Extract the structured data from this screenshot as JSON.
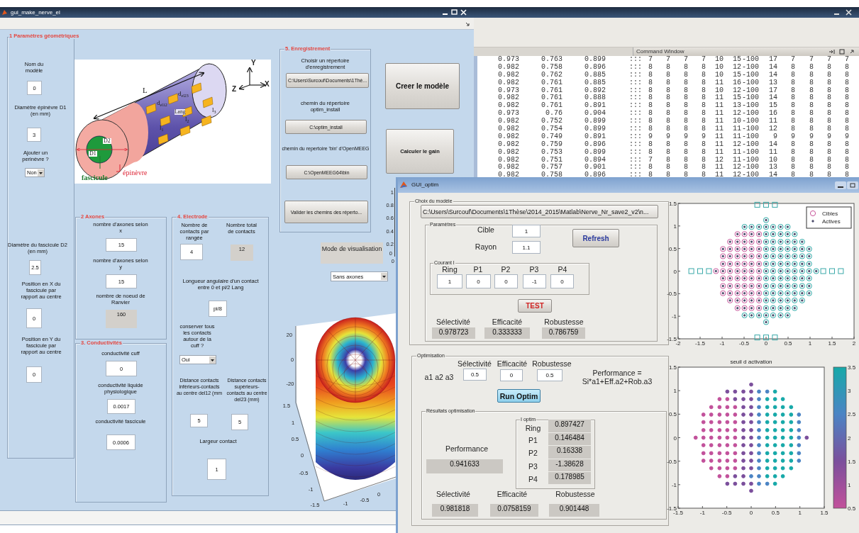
{
  "command_window": {
    "title": "Command Window",
    "rows": [
      [
        "0.973",
        "0.763",
        "0.899",
        ":::",
        "7",
        "7",
        "7",
        "7",
        "10",
        "15",
        "-100",
        "17",
        "7",
        "7",
        "7",
        "7"
      ],
      [
        "0.982",
        "0.758",
        "0.896",
        ":::",
        "8",
        "8",
        "8",
        "8",
        "10",
        "12",
        "-100",
        "14",
        "8",
        "8",
        "8",
        "8"
      ],
      [
        "0.982",
        "0.762",
        "0.885",
        ":::",
        "8",
        "8",
        "8",
        "8",
        "10",
        "15",
        "-100",
        "14",
        "8",
        "8",
        "8",
        "8"
      ],
      [
        "0.982",
        "0.761",
        "0.885",
        ":::",
        "8",
        "8",
        "8",
        "8",
        "11",
        "16",
        "-100",
        "13",
        "8",
        "8",
        "8",
        "8"
      ],
      [
        "0.973",
        "0.761",
        "0.892",
        ":::",
        "8",
        "8",
        "8",
        "8",
        "10",
        "12",
        "-100",
        "17",
        "8",
        "8",
        "8",
        "8"
      ],
      [
        "0.982",
        "0.761",
        "0.888",
        ":::",
        "8",
        "8",
        "8",
        "8",
        "11",
        "15",
        "-100",
        "14",
        "8",
        "8",
        "8",
        "8"
      ],
      [
        "0.982",
        "0.761",
        "0.891",
        ":::",
        "8",
        "8",
        "8",
        "8",
        "11",
        "13",
        "-100",
        "15",
        "8",
        "8",
        "8",
        "8"
      ],
      [
        "0.973",
        "0.76",
        "0.904",
        ":::",
        "8",
        "8",
        "8",
        "8",
        "11",
        "12",
        "-100",
        "16",
        "8",
        "8",
        "8",
        "8"
      ],
      [
        "0.982",
        "0.752",
        "0.899",
        ":::",
        "8",
        "8",
        "8",
        "8",
        "11",
        "10",
        "-100",
        "11",
        "8",
        "8",
        "8",
        "8"
      ],
      [
        "0.982",
        "0.754",
        "0.899",
        ":::",
        "8",
        "8",
        "8",
        "8",
        "11",
        "11",
        "-100",
        "12",
        "8",
        "8",
        "8",
        "8"
      ],
      [
        "0.982",
        "0.749",
        "0.891",
        ":::",
        "9",
        "9",
        "9",
        "9",
        "11",
        "11",
        "-100",
        "9",
        "9",
        "9",
        "9",
        "9"
      ],
      [
        "0.982",
        "0.759",
        "0.896",
        ":::",
        "8",
        "8",
        "8",
        "8",
        "11",
        "12",
        "-100",
        "14",
        "8",
        "8",
        "8",
        "8"
      ],
      [
        "0.982",
        "0.753",
        "0.899",
        ":::",
        "8",
        "8",
        "8",
        "8",
        "11",
        "11",
        "-100",
        "11",
        "8",
        "8",
        "8",
        "8"
      ],
      [
        "0.982",
        "0.751",
        "0.894",
        ":::",
        "7",
        "8",
        "8",
        "8",
        "12",
        "11",
        "-100",
        "10",
        "8",
        "8",
        "8",
        "8"
      ],
      [
        "0.982",
        "0.757",
        "0.901",
        ":::",
        "8",
        "8",
        "8",
        "8",
        "11",
        "12",
        "-100",
        "13",
        "8",
        "8",
        "8",
        "8"
      ],
      [
        "0.982",
        "0.758",
        "0.896",
        ":::",
        "8",
        "8",
        "8",
        "8",
        "11",
        "12",
        "-100",
        "14",
        "8",
        "8",
        "8",
        "8"
      ]
    ]
  },
  "main_window": {
    "title": "gui_make_nerve_el",
    "panels": [
      {
        "title": "1 Paramètres géométriques",
        "items": [
          {
            "kind": "label",
            "text": "Nom du modèle"
          },
          {
            "kind": "edit",
            "value": "0"
          },
          {
            "kind": "label",
            "text": "Diamètre épinèvre D1 (en mm)"
          },
          {
            "kind": "edit",
            "value": "3"
          },
          {
            "kind": "label",
            "text": "Ajouter un perinèvre ?"
          },
          {
            "kind": "popup",
            "value": "Non"
          },
          {
            "kind": "label",
            "text": "Diamètre du fascicule D2 (en mm)"
          },
          {
            "kind": "edit",
            "value": "2.5"
          },
          {
            "kind": "label",
            "text": "Position en X du fascicule par rapport au centre"
          },
          {
            "kind": "edit",
            "value": "0"
          },
          {
            "kind": "label",
            "text": "Position en Y du fascicule par rapport au centre"
          },
          {
            "kind": "edit",
            "value": "0"
          }
        ]
      },
      {
        "title": "2 Axones",
        "items": [
          {
            "kind": "label",
            "text": "nombre d'axones selon x"
          },
          {
            "kind": "edit",
            "value": "15"
          },
          {
            "kind": "label",
            "text": "nombre d'axones selon y"
          },
          {
            "kind": "edit",
            "value": "15"
          },
          {
            "kind": "label",
            "text": "nombre de noeud de Ranvier"
          },
          {
            "kind": "display",
            "value": "160"
          }
        ]
      },
      {
        "title": "3. Conductivités",
        "items": [
          {
            "kind": "label",
            "text": "conductivité cuff"
          },
          {
            "kind": "edit",
            "value": "0"
          },
          {
            "kind": "label",
            "text": "conductivité liquide physiologique"
          },
          {
            "kind": "edit",
            "value": "0.0017"
          },
          {
            "kind": "label",
            "text": "conductivité fascicule"
          },
          {
            "kind": "edit",
            "value": "0.0006"
          }
        ]
      },
      {
        "title": "4. Electrode",
        "items": [
          {
            "kind": "label",
            "text": "Nombre de contacts par rangée"
          },
          {
            "kind": "label",
            "text": "Nombre total de contacts"
          },
          {
            "kind": "edit",
            "value": "4"
          },
          {
            "kind": "display",
            "value": "12"
          },
          {
            "kind": "label",
            "text": "Longueur angulaire d'un contact entre 0 et pi/2 Lang"
          },
          {
            "kind": "edit",
            "value": "pi/8"
          },
          {
            "kind": "label",
            "text": "conserver tous les contacts autour de la cuff ?"
          },
          {
            "kind": "popup",
            "value": "Oui"
          },
          {
            "kind": "label",
            "text": "Distance contacts inférieurs-contacts au centre del12 (mm"
          },
          {
            "kind": "label",
            "text": "Distance contacts supérieurs-contacts au centre del23 (mm)"
          },
          {
            "kind": "edit",
            "value": "5"
          },
          {
            "kind": "edit",
            "value": "5"
          },
          {
            "kind": "label",
            "text": "Largeur contact"
          },
          {
            "kind": "edit",
            "value": "1"
          }
        ]
      },
      {
        "title": "5. Enregistrement",
        "items": [
          {
            "kind": "label",
            "text": "Choisir un répertoire d'enregistrement"
          },
          {
            "kind": "button",
            "label": "C:\\Users\\Surcouf\\Documents\\1Thè..."
          },
          {
            "kind": "label",
            "text": "chemin du répertoire optim_install"
          },
          {
            "kind": "button",
            "label": "C:\\optim_install"
          },
          {
            "kind": "label",
            "text": "chemin du repertoire 'bin' d'OpenMEEG"
          },
          {
            "kind": "button",
            "label": "C:\\OpenMEEG64\\bin"
          },
          {
            "kind": "button",
            "label": "Valider les chemins des réperto..."
          }
        ]
      }
    ],
    "buttons": [
      "Creer le modèle",
      "Calculer le gain"
    ],
    "visualisation": {
      "label": "Mode de  visualisation",
      "value": "Sans axones"
    },
    "nerve_figure": {
      "labels": [
        "L",
        "d$_{el23}$",
        "d$_{el12}$",
        "Lang",
        "l$_{3}$",
        "l$_{2}$",
        "l$_{1}$",
        "D2",
        "D1",
        "fascicule",
        "épinèvre",
        "Y",
        "Z",
        "X"
      ]
    },
    "background_axes": {
      "y_ticks": [
        "1",
        "0.8",
        "0.6",
        "0.4",
        "0.2",
        "0"
      ],
      "x_ticks": [
        "0"
      ]
    },
    "mesh_plot": {
      "z_ticks": [
        "20",
        "0",
        "-20"
      ],
      "y_ticks": [
        "1.5",
        "1",
        "0.5",
        "0",
        "-0.5",
        "-1",
        "-1.5"
      ],
      "x_ticks": [
        "-1",
        "-0.5",
        "0"
      ]
    }
  },
  "optim_window": {
    "title": "GUI_optim",
    "model_panel": {
      "title": "Choix du modèle",
      "path": "C:\\Users\\Surcouf\\Documents\\1Thèse\\2014_2015\\Matlab\\Nerve_Nr_save2_v2\\n...",
      "params": {
        "title": "Paramètres",
        "fields": [
          {
            "label": "Cible",
            "value": "1"
          },
          {
            "label": "Rayon",
            "value": "1.1"
          }
        ],
        "refresh": "Refresh",
        "current": {
          "title": "Courant I",
          "channels": [
            {
              "label": "Ring",
              "value": "1"
            },
            {
              "label": "P1",
              "value": "0"
            },
            {
              "label": "P2",
              "value": "0"
            },
            {
              "label": "P3",
              "value": "-1"
            },
            {
              "label": "P4",
              "value": "0"
            }
          ]
        },
        "test": "TEST",
        "metrics": [
          {
            "label": "Sélectivité",
            "value": "0.978723"
          },
          {
            "label": "Efficacité",
            "value": "0.333333"
          },
          {
            "label": "Robustesse",
            "value": "0.786759"
          }
        ]
      }
    },
    "optimisation": {
      "title": "Optimisation",
      "weights": [
        {
          "label": "Sélectivité",
          "value": "0.5"
        },
        {
          "label": "Efficacité",
          "value": "0"
        },
        {
          "label": "Robustesse",
          "value": "0.5"
        }
      ],
      "weights_label": "a1 a2 a3",
      "formula": "Performance = Si*a1+Eff.a2+Rob.a3",
      "run": "Run Optim",
      "results": {
        "title": "Résultats optimisation",
        "currents": {
          "title": "I optim",
          "rows": [
            {
              "label": "Ring",
              "value": "0.897427"
            },
            {
              "label": "P1",
              "value": "0.146484"
            },
            {
              "label": "P2",
              "value": "0.16338"
            },
            {
              "label": "P3",
              "value": "-1.38628"
            },
            {
              "label": "P4",
              "value": "0.178985"
            }
          ]
        },
        "performance_label": "Performance",
        "performance": "0.941633",
        "metrics": [
          {
            "label": "Sélectivité",
            "value": "0.981818"
          },
          {
            "label": "Efficacité",
            "value": "0.0758159"
          },
          {
            "label": "Robustesse",
            "value": "0.901448"
          }
        ]
      }
    },
    "plots": [
      {
        "chart_data": {
          "type": "scatter",
          "legend": true,
          "xlim": [
            -2,
            2
          ],
          "ylim": [
            -1.5,
            1.5
          ],
          "xticks": [
            {
              "value": -2,
              "label": "-2"
            },
            {
              "value": -1.5,
              "label": "-1.5"
            },
            {
              "value": -1,
              "label": "-1"
            },
            {
              "value": -0.5,
              "label": "-0.5"
            },
            {
              "value": 0,
              "label": "0"
            },
            {
              "value": 0.5,
              "label": "0.5"
            },
            {
              "value": 1,
              "label": "1"
            },
            {
              "value": 1.5,
              "label": "1.5"
            },
            {
              "value": 2,
              "label": "2"
            }
          ],
          "yticks": [
            {
              "value": -1.5,
              "label": "-1.5"
            },
            {
              "value": -1,
              "label": "-1"
            },
            {
              "value": -0.5,
              "label": "-0.5"
            },
            {
              "value": 0,
              "label": "0"
            },
            {
              "value": 0.5,
              "label": "0.5"
            },
            {
              "value": 1,
              "label": "1"
            },
            {
              "value": 1.5,
              "label": "1.5"
            }
          ],
          "series": [
            {
              "name": "Cibles",
              "color": "#c8559b",
              "marker": "circle",
              "x": [
                -0.65,
                -0.49,
                -0.33,
                -0.16,
                -0.82,
                -0.65,
                -0.49,
                -0.33,
                -0.16,
                -0.98,
                -0.82,
                -0.65,
                -0.49,
                -0.33,
                -0.16,
                -0.98,
                -0.82,
                -0.65,
                -0.49,
                -0.33,
                -0.16,
                -0.98,
                -0.82,
                -0.65,
                -0.49,
                -0.33,
                -0.16,
                -0.98,
                -0.82,
                -0.65,
                -0.49,
                -0.33,
                -0.16,
                -0.98,
                -0.82,
                -0.65,
                -0.49,
                -0.33,
                -0.16,
                -0.98,
                -0.82,
                -0.65,
                -0.49,
                -0.33,
                -0.16,
                -0.98,
                -0.82,
                -0.65,
                -0.49,
                -0.33,
                -0.16,
                -0.82,
                -0.65,
                -0.49,
                -0.33,
                -0.16,
                -0.65,
                -0.49,
                -0.33,
                -0.16,
                -1.14
              ],
              "values": [
                0.82,
                0.82,
                0.82,
                0.82,
                0.65,
                0.65,
                0.65,
                0.65,
                0.65,
                0.49,
                0.49,
                0.49,
                0.49,
                0.49,
                0.49,
                0.33,
                0.33,
                0.33,
                0.33,
                0.33,
                0.33,
                0.16,
                0.16,
                0.16,
                0.16,
                0.16,
                0.16,
                0,
                0,
                0,
                0,
                0,
                0,
                -0.16,
                -0.16,
                -0.16,
                -0.16,
                -0.16,
                -0.16,
                -0.33,
                -0.33,
                -0.33,
                -0.33,
                -0.33,
                -0.33,
                -0.49,
                -0.49,
                -0.49,
                -0.49,
                -0.49,
                -0.49,
                -0.65,
                -0.65,
                -0.65,
                -0.65,
                -0.65,
                -0.82,
                -0.82,
                -0.82,
                -0.82,
                0
              ]
            },
            {
              "color": "#2aa8a6",
              "marker": "circle",
              "x": [
                -0.49,
                -0.33,
                -0.16,
                0,
                0.16,
                0.33,
                0.49,
                0,
                0.16,
                0.33,
                0.49,
                0.65,
                0,
                0.16,
                0.33,
                0.49,
                0.65,
                0.82,
                0,
                0.16,
                0.33,
                0.49,
                0.65,
                0.82,
                0.98,
                0,
                0.16,
                0.33,
                0.49,
                0.65,
                0.82,
                0.98,
                0,
                0.16,
                0.33,
                0.49,
                0.65,
                0.82,
                0.98,
                0,
                0.16,
                0.33,
                0.49,
                0.65,
                0.82,
                0.98,
                0,
                0.16,
                0.33,
                0.49,
                0.65,
                0.82,
                0.98,
                0,
                0.16,
                0.33,
                0.49,
                0.65,
                0.82,
                0.98,
                0,
                0.16,
                0.33,
                0.49,
                0.65,
                0.82,
                0.98,
                0,
                0.16,
                0.33,
                0.49,
                0.65,
                0.82,
                0,
                0.16,
                0.33,
                0.49,
                0.65,
                -0.49,
                -0.33,
                -0.16,
                0,
                0.16,
                0.33,
                0.49,
                0,
                0,
                1.14
              ],
              "values": [
                0.98,
                0.98,
                0.98,
                0.98,
                0.98,
                0.98,
                0.98,
                0.82,
                0.82,
                0.82,
                0.82,
                0.82,
                0.65,
                0.65,
                0.65,
                0.65,
                0.65,
                0.65,
                0.49,
                0.49,
                0.49,
                0.49,
                0.49,
                0.49,
                0.49,
                0.33,
                0.33,
                0.33,
                0.33,
                0.33,
                0.33,
                0.33,
                0.16,
                0.16,
                0.16,
                0.16,
                0.16,
                0.16,
                0.16,
                0,
                0,
                0,
                0,
                0,
                0,
                0,
                -0.16,
                -0.16,
                -0.16,
                -0.16,
                -0.16,
                -0.16,
                -0.16,
                -0.33,
                -0.33,
                -0.33,
                -0.33,
                -0.33,
                -0.33,
                -0.33,
                -0.49,
                -0.49,
                -0.49,
                -0.49,
                -0.49,
                -0.49,
                -0.49,
                -0.65,
                -0.65,
                -0.65,
                -0.65,
                -0.65,
                -0.65,
                -0.82,
                -0.82,
                -0.82,
                -0.82,
                -0.82,
                -0.98,
                -0.98,
                -0.98,
                -0.98,
                -0.98,
                -0.98,
                -0.98,
                1.13,
                -1.13,
                0
              ]
            },
            {
              "name": "Actives",
              "color": "#4a4a6a",
              "x": [
                -0.65,
                -0.49,
                -0.33,
                -0.16,
                -0.82,
                -0.65,
                -0.49,
                -0.33,
                -0.16,
                -0.98,
                -0.82,
                -0.65,
                -0.49,
                -0.33,
                -0.16,
                -0.98,
                -0.82,
                -0.65,
                -0.49,
                -0.33,
                -0.16,
                -0.98,
                -0.82,
                -0.65,
                -0.49,
                -0.33,
                -0.16,
                -0.98,
                -0.82,
                -0.65,
                -0.49,
                -0.33,
                -0.16,
                -0.98,
                -0.82,
                -0.65,
                -0.49,
                -0.33,
                -0.16,
                -0.98,
                -0.82,
                -0.65,
                -0.49,
                -0.33,
                -0.16,
                -0.98,
                -0.82,
                -0.65,
                -0.49,
                -0.33,
                -0.16,
                -0.82,
                -0.65,
                -0.49,
                -0.33,
                -0.16,
                -0.65,
                -0.49,
                -0.33,
                -0.16,
                -1.14,
                -0.49,
                -0.33,
                -0.16,
                0,
                0.16,
                0.33,
                0.49,
                0,
                0.16,
                0.33,
                0.49,
                0.65,
                0,
                0.16,
                0.33,
                0.49,
                0.65,
                0.82,
                0,
                0.16,
                0.33,
                0.49,
                0.65,
                0.82,
                0.98,
                0,
                0.16,
                0.33,
                0.49,
                0.65,
                0.82,
                0.98,
                0,
                0.16,
                0.33,
                0.49,
                0.65,
                0.82,
                0.98,
                0,
                0.16,
                0.33,
                0.49,
                0.65,
                0.82,
                0.98,
                0,
                0.16,
                0.33,
                0.49,
                0.65,
                0.82,
                0.98,
                0,
                0.16,
                0.33,
                0.49,
                0.65,
                0.82,
                0.98,
                0,
                0.16,
                0.33,
                0.49,
                0.65,
                0.82,
                0.98,
                0,
                0.16,
                0.33,
                0.49,
                0.65,
                0.82,
                0,
                0.16,
                0.33,
                0.49,
                0.65,
                -0.49,
                -0.33,
                -0.16,
                0,
                0.16,
                0.33,
                0.49,
                0,
                0,
                1.14
              ],
              "values": [
                0.82,
                0.82,
                0.82,
                0.82,
                0.65,
                0.65,
                0.65,
                0.65,
                0.65,
                0.49,
                0.49,
                0.49,
                0.49,
                0.49,
                0.49,
                0.33,
                0.33,
                0.33,
                0.33,
                0.33,
                0.33,
                0.16,
                0.16,
                0.16,
                0.16,
                0.16,
                0.16,
                0,
                0,
                0,
                0,
                0,
                0,
                -0.16,
                -0.16,
                -0.16,
                -0.16,
                -0.16,
                -0.16,
                -0.33,
                -0.33,
                -0.33,
                -0.33,
                -0.33,
                -0.33,
                -0.49,
                -0.49,
                -0.49,
                -0.49,
                -0.49,
                -0.49,
                -0.65,
                -0.65,
                -0.65,
                -0.65,
                -0.65,
                -0.82,
                -0.82,
                -0.82,
                -0.82,
                0,
                0.98,
                0.98,
                0.98,
                0.98,
                0.98,
                0.98,
                0.98,
                0.82,
                0.82,
                0.82,
                0.82,
                0.82,
                0.65,
                0.65,
                0.65,
                0.65,
                0.65,
                0.65,
                0.49,
                0.49,
                0.49,
                0.49,
                0.49,
                0.49,
                0.49,
                0.33,
                0.33,
                0.33,
                0.33,
                0.33,
                0.33,
                0.33,
                0.16,
                0.16,
                0.16,
                0.16,
                0.16,
                0.16,
                0.16,
                0,
                0,
                0,
                0,
                0,
                0,
                0,
                -0.16,
                -0.16,
                -0.16,
                -0.16,
                -0.16,
                -0.16,
                -0.16,
                -0.33,
                -0.33,
                -0.33,
                -0.33,
                -0.33,
                -0.33,
                -0.33,
                -0.49,
                -0.49,
                -0.49,
                -0.49,
                -0.49,
                -0.49,
                -0.49,
                -0.65,
                -0.65,
                -0.65,
                -0.65,
                -0.65,
                -0.65,
                -0.82,
                -0.82,
                -0.82,
                -0.82,
                -0.82,
                -0.98,
                -0.98,
                -0.98,
                -0.98,
                -0.98,
                -0.98,
                -0.98,
                1.13,
                -1.13,
                0
              ]
            },
            {
              "color": "#3aa9a9",
              "marker": "square",
              "x": [
                -0.2,
                0,
                0.2,
                -0.2,
                0,
                0.2,
                -1.7,
                -1.5,
                -1.3,
                1.3,
                1.5,
                1.7
              ],
              "values": [
                1.47,
                1.47,
                1.47,
                -1.47,
                -1.47,
                -1.47,
                0,
                0,
                0,
                0,
                0,
                0
              ]
            }
          ]
        }
      },
      {
        "chart_data": {
          "type": "scatter",
          "title": "seuil d activation",
          "xlim": [
            -1.5,
            1.5
          ],
          "ylim": [
            -1.5,
            1.5
          ],
          "xticks": [
            {
              "value": -1.5,
              "label": "-1.5"
            },
            {
              "value": -1,
              "label": "-1"
            },
            {
              "value": -0.5,
              "label": "-0.5"
            },
            {
              "value": 0,
              "label": "0"
            },
            {
              "value": 0.5,
              "label": "0.5"
            },
            {
              "value": 1,
              "label": "1"
            },
            {
              "value": 1.5,
              "label": "1.5"
            }
          ],
          "yticks": [
            {
              "value": -1.5,
              "label": "-1.5"
            },
            {
              "value": -1,
              "label": "-1"
            },
            {
              "value": -0.5,
              "label": "-0.5"
            },
            {
              "value": 0,
              "label": "0"
            },
            {
              "value": 0.5,
              "label": "0.5"
            },
            {
              "value": 1,
              "label": "1"
            },
            {
              "value": 1.5,
              "label": "1.5"
            }
          ],
          "series": [
            {
              "color": "#c2519b",
              "x": [
                -0.65,
                -0.49,
                -0.82,
                -0.65,
                -0.49,
                -0.33,
                -0.98,
                -0.82,
                -0.65,
                -0.49,
                -0.33,
                -0.98,
                -0.82,
                -0.65,
                -0.49,
                -0.33,
                -0.98,
                -0.82,
                -0.65,
                -0.49,
                -0.33,
                -0.98,
                -0.82,
                -0.65,
                -0.49,
                -0.33,
                -0.98,
                -0.82,
                -0.65,
                -0.49,
                -0.33,
                -0.98,
                -0.82,
                -0.65,
                -0.49,
                -0.33,
                -0.98,
                -0.82,
                -0.65,
                -0.49,
                -0.33,
                -0.82,
                -0.65,
                -0.49,
                -0.33,
                -0.65,
                -0.49,
                -1.14
              ],
              "values": [
                0.82,
                0.82,
                0.65,
                0.65,
                0.65,
                0.65,
                0.49,
                0.49,
                0.49,
                0.49,
                0.49,
                0.33,
                0.33,
                0.33,
                0.33,
                0.33,
                0.16,
                0.16,
                0.16,
                0.16,
                0.16,
                0,
                0,
                0,
                0,
                0,
                -0.16,
                -0.16,
                -0.16,
                -0.16,
                -0.16,
                -0.33,
                -0.33,
                -0.33,
                -0.33,
                -0.33,
                -0.49,
                -0.49,
                -0.49,
                -0.49,
                -0.49,
                -0.65,
                -0.65,
                -0.65,
                -0.65,
                -0.82,
                -0.82,
                0
              ]
            },
            {
              "color": "#7b4f9c",
              "x": [
                -0.49,
                -0.33,
                -0.16,
                0,
                -0.33,
                -0.16,
                0,
                -0.16,
                0,
                -0.16,
                0,
                -0.16,
                0,
                -0.16,
                0,
                -0.16,
                0,
                -0.16,
                0,
                -0.16,
                0,
                -0.16,
                0,
                -0.16,
                0,
                -0.33,
                -0.16,
                -0.49,
                -0.33,
                -0.16,
                0,
                0,
                0,
                1.14
              ],
              "values": [
                0.98,
                0.98,
                0.98,
                0.98,
                0.82,
                0.82,
                0.82,
                0.65,
                0.65,
                0.49,
                0.49,
                0.33,
                0.33,
                0.16,
                0.16,
                0,
                0,
                -0.16,
                -0.16,
                -0.33,
                -0.33,
                -0.49,
                -0.49,
                -0.65,
                -0.65,
                -0.82,
                -0.82,
                -0.98,
                -0.98,
                -0.98,
                -0.98,
                1.13,
                -1.13,
                0
              ]
            },
            {
              "color": "#4b84c4",
              "x": [
                0.16,
                0.33,
                0.16,
                0.16,
                0.16,
                0.98,
                0.16,
                0.98,
                0.16,
                0.98,
                0.16,
                0.98,
                0.16,
                0.98,
                0.16,
                0.98,
                0.16,
                0.98,
                0.16,
                0,
                0.16,
                0.16,
                0.33
              ],
              "values": [
                0.98,
                0.98,
                0.82,
                0.65,
                0.49,
                0.49,
                0.33,
                0.33,
                0.16,
                0.16,
                0,
                0,
                -0.16,
                -0.16,
                -0.33,
                -0.33,
                -0.49,
                -0.49,
                -0.65,
                -0.82,
                -0.82,
                -0.98,
                -0.98
              ]
            },
            {
              "color": "#17a9a9",
              "x": [
                0.49,
                0.33,
                0.49,
                0.65,
                0.33,
                0.49,
                0.65,
                0.82,
                0.33,
                0.49,
                0.65,
                0.82,
                0.33,
                0.49,
                0.65,
                0.82,
                0.33,
                0.49,
                0.65,
                0.82,
                0.33,
                0.49,
                0.65,
                0.82,
                0.33,
                0.49,
                0.65,
                0.82,
                0.33,
                0.49,
                0.65,
                0.82,
                0.33,
                0.49,
                0.65,
                0.82,
                0.33,
                0.49,
                0.65,
                0.82,
                0.33,
                0.49,
                0.65,
                0.49
              ],
              "values": [
                0.98,
                0.82,
                0.82,
                0.82,
                0.65,
                0.65,
                0.65,
                0.65,
                0.49,
                0.49,
                0.49,
                0.49,
                0.33,
                0.33,
                0.33,
                0.33,
                0.16,
                0.16,
                0.16,
                0.16,
                0,
                0,
                0,
                0,
                -0.16,
                -0.16,
                -0.16,
                -0.16,
                -0.33,
                -0.33,
                -0.33,
                -0.33,
                -0.49,
                -0.49,
                -0.49,
                -0.49,
                -0.65,
                -0.65,
                -0.65,
                -0.65,
                -0.82,
                -0.82,
                -0.82,
                -0.98
              ]
            }
          ]
        },
        "colorbar": {
          "ticks": [
            "3.5",
            "3",
            "2.5",
            "2",
            "1.5",
            "1",
            "0.5"
          ]
        }
      }
    ]
  }
}
